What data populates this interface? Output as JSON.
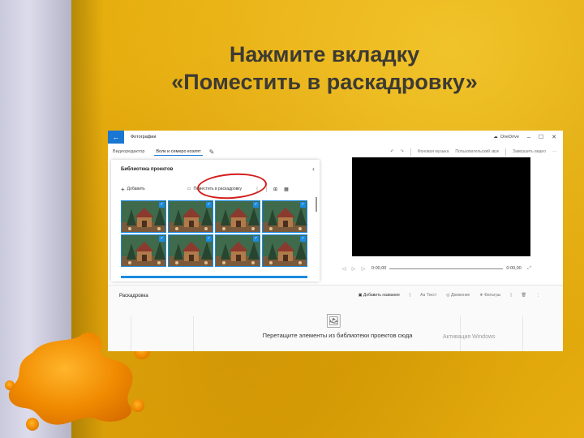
{
  "slide": {
    "title_line1": "Нажмите вкладку",
    "title_line2": "«Поместить в раскадровку»"
  },
  "app": {
    "name": "Фотографии",
    "onedrive_label": "OneDrive",
    "breadcrumb": "Видеоредактор",
    "project_name": "Волк и семеро козлят",
    "commands": [
      "Фоновая музыка",
      "Пользовательский звук",
      "Завершить видео"
    ],
    "library": {
      "title": "Библиотека проектов",
      "add_label": "Добавить",
      "place_label": "Поместить в раскадровку",
      "thumb_count": 8
    },
    "player": {
      "current_time": "0:00,00",
      "total_time": "0:00,00"
    },
    "storyboard": {
      "title": "Раскадровка",
      "add_title_label": "Добавить название",
      "tools": [
        "Текст",
        "Движение",
        "Фильтры"
      ],
      "drop_hint": "Перетащите элементы из библиотеки проектов сюда",
      "watermark": "Активация Windows"
    }
  },
  "colors": {
    "accent": "#1976d2",
    "highlight_oval": "#d21c1c",
    "background": "#e3a70c"
  }
}
